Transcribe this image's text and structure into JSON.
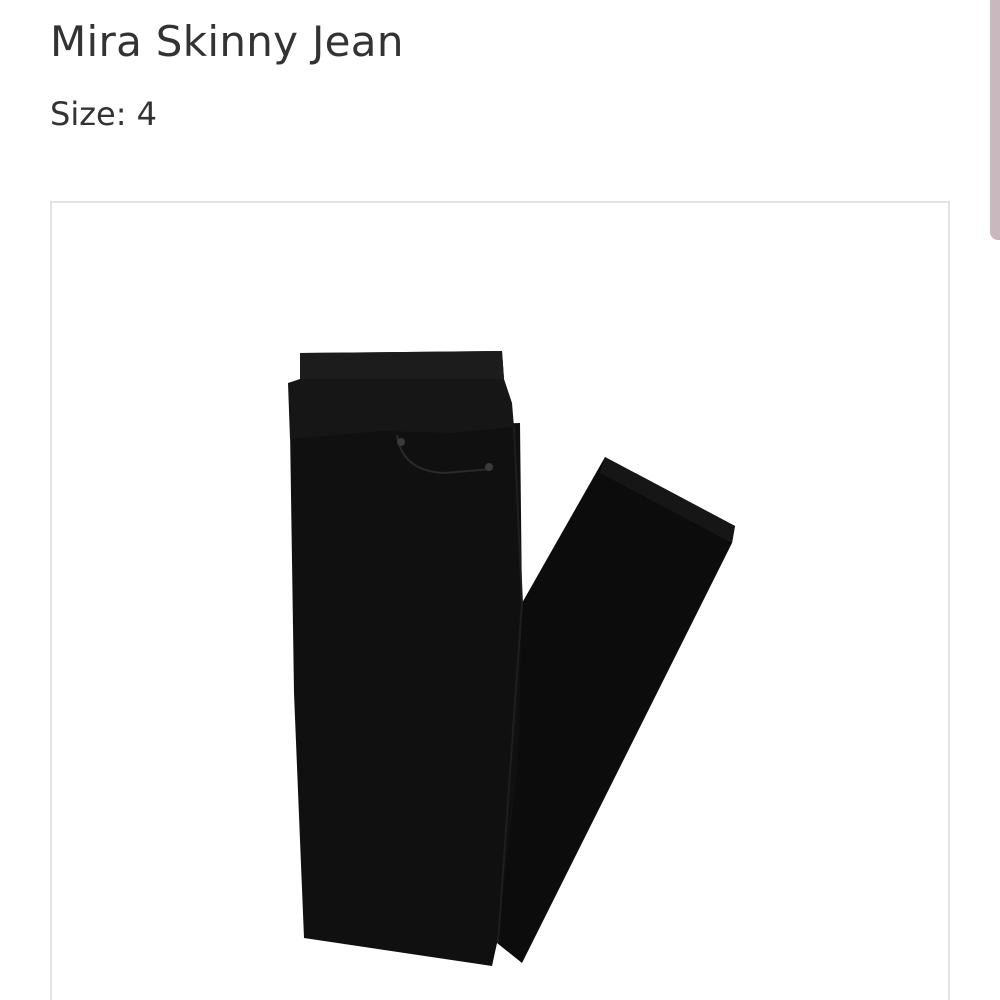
{
  "product": {
    "title": "Mira Skinny Jean",
    "size_line": "Size: 4"
  },
  "image": {
    "subject": "black-skinny-jeans",
    "alt": "Mira Skinny Jean"
  },
  "colors": {
    "text": "#333333",
    "card_border": "#e6e3df",
    "garment": "#111111",
    "scrollbar": "#c9b8bd"
  },
  "icons": {
    "scrollbar": "scrollbar-thumb"
  }
}
